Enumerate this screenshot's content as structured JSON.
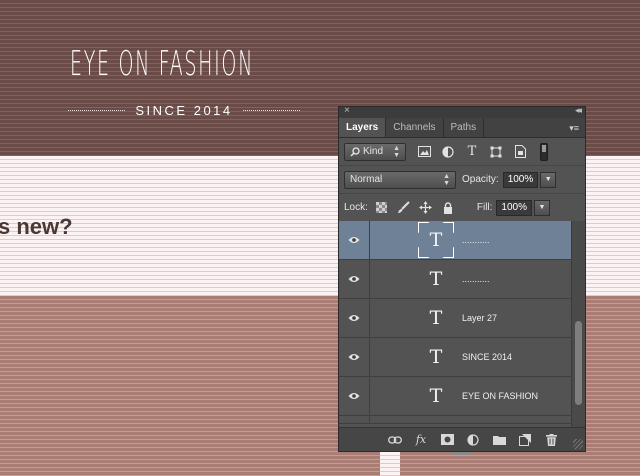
{
  "canvas": {
    "brand_title": "EYE ON FASHION",
    "brand_subtitle": "SINCE 2014",
    "section_heading": "s new?"
  },
  "panel": {
    "close_glyph": "×",
    "collapse_glyph": "◂◂",
    "tabs": [
      {
        "label": "Layers",
        "active": true
      },
      {
        "label": "Channels",
        "active": false
      },
      {
        "label": "Paths",
        "active": false
      }
    ],
    "filter": {
      "kind_label": "Kind"
    },
    "blend_mode": "Normal",
    "opacity_label": "Opacity:",
    "opacity_value": "100%",
    "lock_label": "Lock:",
    "fill_label": "Fill:",
    "fill_value": "100%",
    "layers": [
      {
        "name": "...........",
        "type_glyph": "T",
        "selected": true
      },
      {
        "name": "...........",
        "type_glyph": "T",
        "selected": false
      },
      {
        "name": "Layer 27",
        "type_glyph": "T",
        "selected": false
      },
      {
        "name": "SINCE 2014",
        "type_glyph": "T",
        "selected": false
      },
      {
        "name": "EYE ON FASHION",
        "type_glyph": "T",
        "selected": false
      }
    ],
    "footer_fx": "fx"
  },
  "colors": {
    "header_band": "#6b4b48",
    "light_band": "#fbf3f3",
    "dark_band": "#a97d74",
    "panel_bg": "#535353",
    "selected_layer": "#6e8196"
  }
}
